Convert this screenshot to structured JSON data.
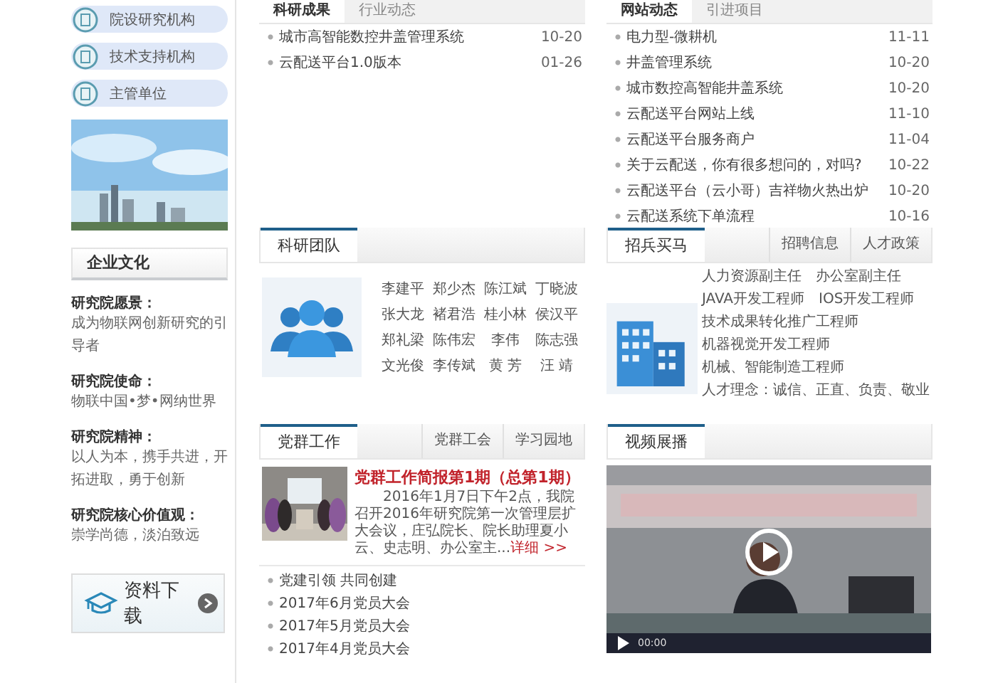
{
  "sidebar": {
    "links": [
      {
        "label": "院设研究机构"
      },
      {
        "label": "技术支持机构"
      },
      {
        "label": "主管单位"
      }
    ],
    "culture": {
      "title": "企业文化",
      "entries": [
        {
          "heading": "研究院愿景：",
          "text": "成为物联网创新研究的引导者"
        },
        {
          "heading": "研究院使命：",
          "text": "物联中国•梦•网纳世界"
        },
        {
          "heading": "研究院精神：",
          "text": "以人为本，携手共进，开拓进取，勇于创新"
        },
        {
          "heading": "研究院核心价值观：",
          "text": "崇学尚德，淡泊致远"
        }
      ]
    },
    "download": {
      "label": "资料下载"
    }
  },
  "research": {
    "tabs": [
      {
        "label": "科研成果",
        "selected": true
      },
      {
        "label": "行业动态",
        "selected": false
      }
    ],
    "items": [
      {
        "title": "城市高智能数控井盖管理系统",
        "date": "10-20"
      },
      {
        "title": "云配送平台1.0版本",
        "date": "01-26"
      }
    ]
  },
  "site_news": {
    "tabs": [
      {
        "label": "网站动态",
        "selected": true
      },
      {
        "label": "引进项目",
        "selected": false
      }
    ],
    "items": [
      {
        "title": "电力型-微耕机",
        "date": "11-11"
      },
      {
        "title": "井盖管理系统",
        "date": "10-20"
      },
      {
        "title": "城市数控高智能井盖系统",
        "date": "10-20"
      },
      {
        "title": "云配送平台网站上线",
        "date": "11-10"
      },
      {
        "title": "云配送平台服务商户",
        "date": "11-04"
      },
      {
        "title": "关于云配送，你有很多想问的，对吗?",
        "date": "10-22"
      },
      {
        "title": "云配送平台（云小哥）吉祥物火热出炉",
        "date": "10-20"
      },
      {
        "title": "云配送系统下单流程",
        "date": "10-16"
      }
    ]
  },
  "team": {
    "tabs": [
      {
        "label": "科研团队",
        "selected": true
      }
    ],
    "members": [
      "李建平",
      "郑少杰",
      "陈江斌",
      "丁晓波",
      "张大龙",
      "褚君浩",
      "桂小林",
      "侯汉平",
      "郑礼梁",
      "陈伟宏",
      "李伟",
      "陈志强",
      "文光俊",
      "李传斌",
      "黄 芳",
      "汪 靖"
    ]
  },
  "recruit": {
    "tabs": [
      {
        "label": "招兵买马",
        "selected": true
      }
    ],
    "links": [
      "招聘信息",
      "人才政策"
    ],
    "jobs": [
      "人力资源副主任",
      "办公室副主任",
      "JAVA开发工程师",
      "IOS开发工程师",
      "技术成果转化推广工程师",
      "机器视觉开发工程师",
      "机械、智能制造工程师"
    ],
    "philosophy": "人才理念：诚信、正直、负责、敬业"
  },
  "party": {
    "tabs": [
      {
        "label": "党群工作",
        "selected": true
      }
    ],
    "links": [
      "党群工会",
      "学习园地"
    ],
    "feature": {
      "title": "党群工作简报第1期（总第1期）",
      "summary": "2016年1月7日下午2点，我院召开2016年研究院第一次管理层扩大会议，庄弘院长、院长助理夏小云、史志明、办公室主...",
      "more": "详细 >>"
    },
    "items": [
      {
        "title": "党建引领 共同创建"
      },
      {
        "title": "2017年6月党员大会"
      },
      {
        "title": "2017年5月党员大会"
      },
      {
        "title": "2017年4月党员大会"
      }
    ]
  },
  "video": {
    "tabs": [
      {
        "label": "视频展播",
        "selected": true
      }
    ],
    "time": "00:00"
  }
}
